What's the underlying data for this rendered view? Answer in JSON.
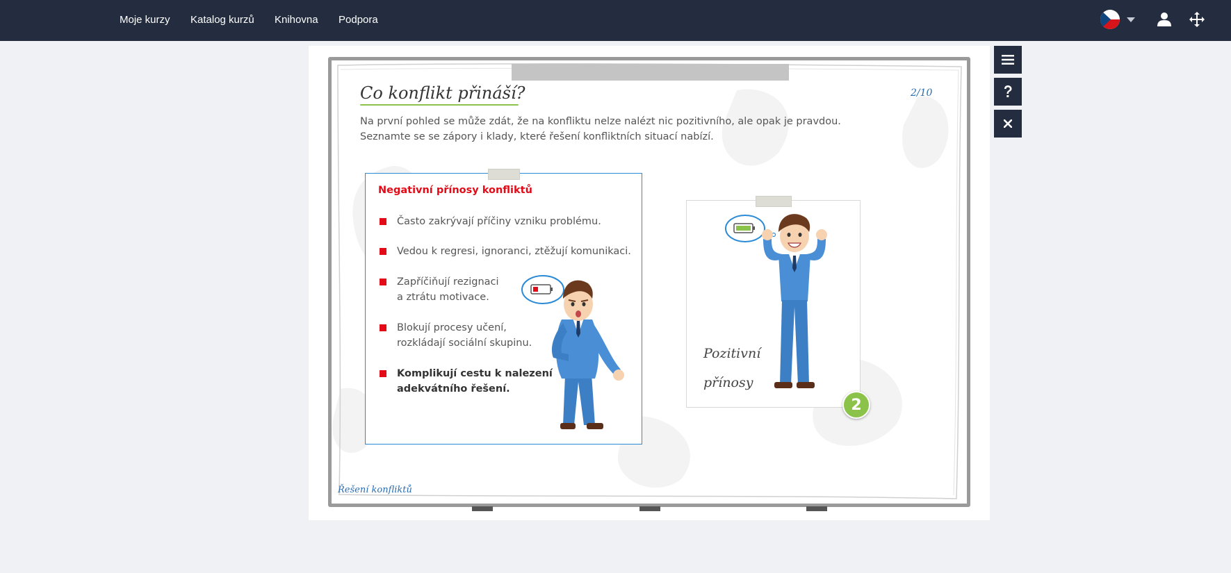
{
  "nav": {
    "items": [
      {
        "label": "Moje kurzy"
      },
      {
        "label": "Katalog kurzů"
      },
      {
        "label": "Knihovna"
      },
      {
        "label": "Podpora"
      }
    ]
  },
  "header_icons": {
    "language": "czech-flag-icon",
    "dropdown": "chevron-down-icon",
    "user": "user-icon",
    "move": "move-icon"
  },
  "side_buttons": [
    "menu-icon",
    "help-icon",
    "close-icon"
  ],
  "slide": {
    "title": "Co konflikt přináší?",
    "page": "2/10",
    "intro_lines": [
      "Na první pohled se může zdát, že na konfliktu nelze nalézt nic pozitivního, ale opak je pravdou.",
      "Seznamte se se zápory i klady, které řešení konfliktních situací nabízí."
    ],
    "negative": {
      "title": "Negativní přínosy konfliktů",
      "items": [
        {
          "lines": [
            "Často zakrývají příčiny vzniku problému."
          ]
        },
        {
          "lines": [
            "Vedou k regresi, ignoranci, ztěžují komunikaci."
          ]
        },
        {
          "lines": [
            "Zapříčiňují rezignaci",
            "a ztrátu motivace."
          ]
        },
        {
          "lines": [
            "Blokují procesy učení,",
            "rozkládají sociální skupinu."
          ]
        },
        {
          "lines": [
            "Komplikují cestu k nalezení",
            "adekvátního řešení."
          ]
        }
      ]
    },
    "positive": {
      "lines": [
        "Pozitivní",
        "přínosy"
      ],
      "badge": "2"
    },
    "footer": "Řešení konfliktů"
  },
  "colors": {
    "topbar": "#232d3f",
    "accent_red": "#e30b17",
    "accent_blue": "#2b8ad6",
    "accent_green": "#8bc34a",
    "page_bg": "#eff1f4"
  }
}
